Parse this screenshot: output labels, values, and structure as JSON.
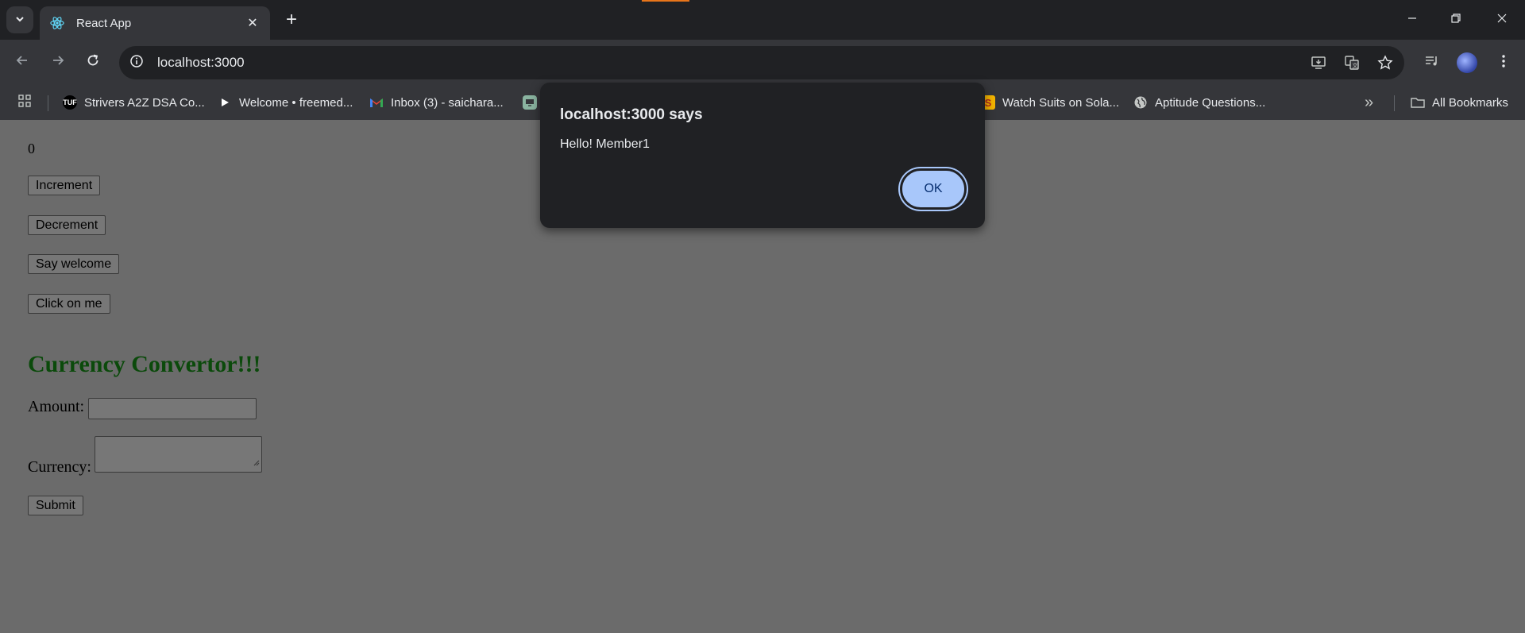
{
  "tabs": [
    {
      "title": "React App"
    }
  ],
  "address_bar": {
    "url": "localhost:3000"
  },
  "bookmarks": [
    {
      "label": "Strivers A2Z DSA Co...",
      "icon": "tuf-icon"
    },
    {
      "label": "Welcome • freemed...",
      "icon": "play-icon"
    },
    {
      "label": "Inbox (3) - saichara...",
      "icon": "gmail-icon"
    },
    {
      "label": "Watch Suits on Sola...",
      "icon": "s-icon"
    },
    {
      "label": "Aptitude Questions...",
      "icon": "globe-icon"
    }
  ],
  "bookmarks_overflow": "»",
  "all_bookmarks_label": "All Bookmarks",
  "page": {
    "counter_value": "0",
    "buttons": [
      "Increment",
      "Decrement",
      "Say welcome",
      "Click on me"
    ],
    "heading": "Currency Convertor!!!",
    "amount_label": "Amount:",
    "currency_label": "Currency:",
    "submit_label": "Submit"
  },
  "dialog": {
    "title": "localhost:3000 says",
    "message": "Hello! Member1",
    "ok_label": "OK"
  },
  "colors": {
    "heading": "#0b4a0b",
    "dialog_bg": "#202124",
    "ok_button": "#a8c7fa"
  }
}
